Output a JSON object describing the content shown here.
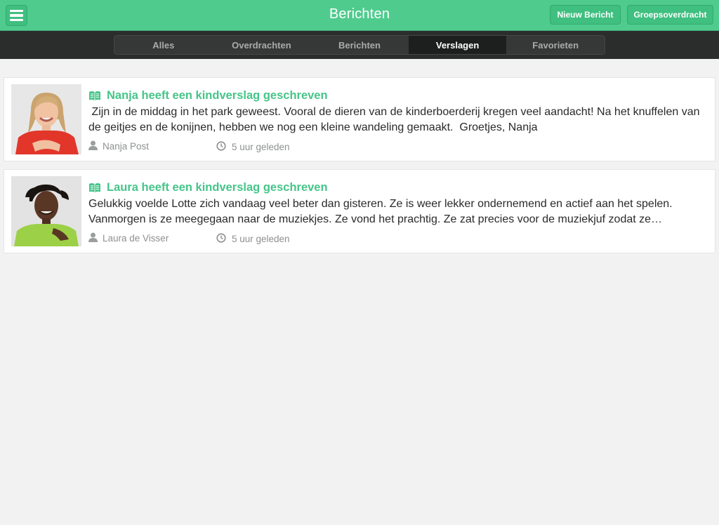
{
  "header": {
    "title": "Berichten",
    "menu_icon": "hamburger-menu-icon",
    "new_message_label": "Nieuw Bericht",
    "group_handover_label": "Groepsoverdracht"
  },
  "tabs": [
    {
      "label": "Alles"
    },
    {
      "label": "Overdrachten"
    },
    {
      "label": "Berichten"
    },
    {
      "label": "Verslagen",
      "active": true
    },
    {
      "label": "Favorieten"
    }
  ],
  "reports": [
    {
      "title": "Nanja heeft een kindverslag geschreven",
      "body": " Zijn in de middag in het park geweest. Vooral de dieren van de kinderboerderij kregen veel aandacht! Na het knuffelen van de geitjes en de konijnen, hebben we nog een kleine wandeling gemaakt.  Groetjes, Nanja",
      "author": "Nanja Post",
      "time": "5 uur geleden",
      "icon": "book-icon"
    },
    {
      "title": "Laura heeft een kindverslag geschreven",
      "body": "Gelukkig voelde Lotte zich vandaag veel beter dan gisteren. Ze is weer lekker ondernemend en actief aan het spelen. Vanmorgen is ze meegegaan naar de muziekjes. Ze vond het prachtig. Ze zat precies voor de muziekjuf zodat ze…",
      "author": "Laura de Visser",
      "time": "5 uur geleden",
      "icon": "book-icon"
    }
  ],
  "colors": {
    "brand_green": "#4fcb8e",
    "title_green": "#45c589",
    "tabbar_dark": "#2b2d2c"
  }
}
